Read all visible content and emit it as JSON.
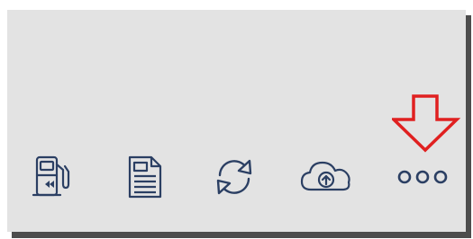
{
  "toolbar": {
    "items": [
      {
        "name": "fuel-station-rewind",
        "icon": "fuel-pump-rewind-icon"
      },
      {
        "name": "document",
        "icon": "document-icon"
      },
      {
        "name": "sync",
        "icon": "sync-icon"
      },
      {
        "name": "cloud-upload",
        "icon": "cloud-upload-icon"
      },
      {
        "name": "more",
        "icon": "more-dots-icon"
      }
    ]
  },
  "annotation": {
    "icon": "down-arrow-icon",
    "target": "more",
    "color": "#e02020"
  },
  "colors": {
    "background": "#e3e3e3",
    "icon": "#2b3f63",
    "shadow": "#4d4d4d"
  }
}
